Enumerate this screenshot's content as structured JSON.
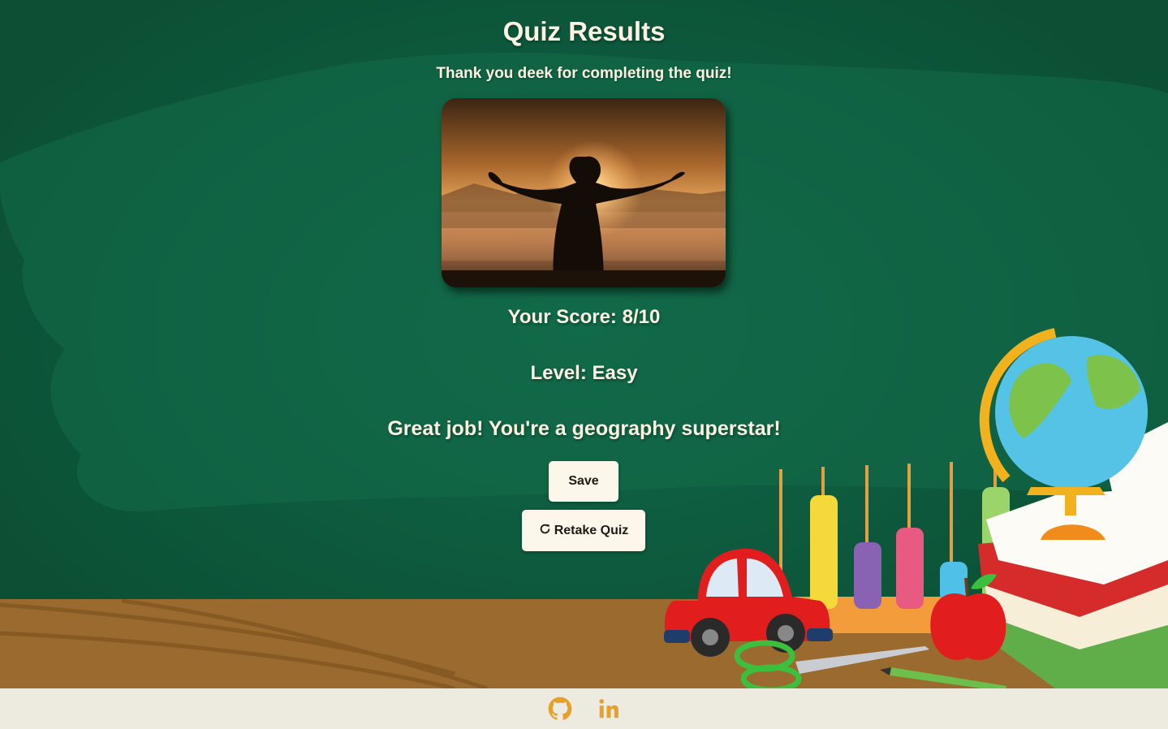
{
  "quiz": {
    "title": "Quiz Results",
    "thanks_message": "Thank you deek for completing the quiz!",
    "score_text": "Your Score: 8/10",
    "level_text": "Level: Easy",
    "feedback": "Great job! You're a geography superstar!"
  },
  "buttons": {
    "save_label": "Save",
    "retake_label": "Retake Quiz",
    "retake_icon": "refresh-icon"
  },
  "footer": {
    "links": [
      {
        "icon": "github-icon"
      },
      {
        "icon": "linkedin-icon"
      }
    ]
  },
  "colors": {
    "background": "#0d5a3c",
    "accent": "#e6a12b",
    "text": "#fbf2e2",
    "button_bg": "#fdf6ea",
    "footer_bg": "#edeae0",
    "desk": "#9a6a2e"
  }
}
